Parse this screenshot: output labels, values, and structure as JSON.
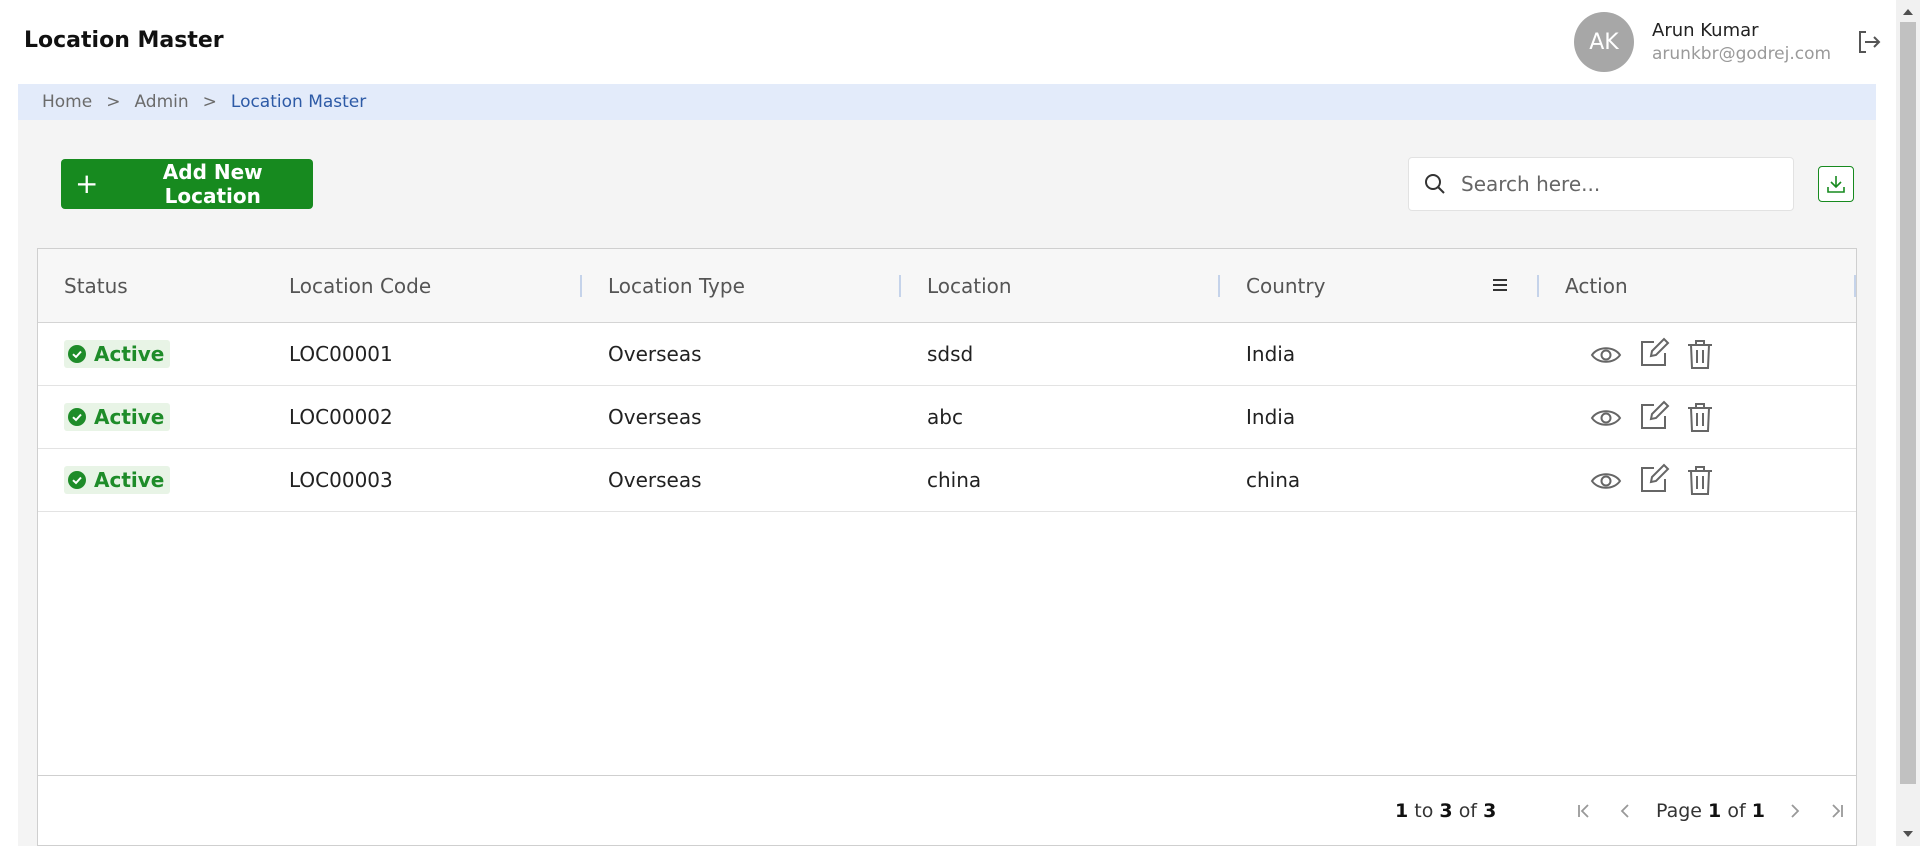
{
  "header": {
    "title": "Location Master",
    "user": {
      "initials": "AK",
      "name": "Arun Kumar",
      "email": "arunkbr@godrej.com"
    }
  },
  "breadcrumb": {
    "items": [
      "Home",
      "Admin",
      "Location Master"
    ],
    "separator": ">"
  },
  "toolbar": {
    "add_label": "Add New Location",
    "search_placeholder": "Search here...",
    "search_value": ""
  },
  "table": {
    "columns": [
      "Status",
      "Location Code",
      "Location Type",
      "Location",
      "Country",
      "Action"
    ],
    "rows": [
      {
        "status": "Active",
        "code": "LOC00001",
        "type": "Overseas",
        "location": "sdsd",
        "country": "India"
      },
      {
        "status": "Active",
        "code": "LOC00002",
        "type": "Overseas",
        "location": "abc",
        "country": "India"
      },
      {
        "status": "Active",
        "code": "LOC00003",
        "type": "Overseas",
        "location": "china",
        "country": "china"
      }
    ]
  },
  "pagination": {
    "from": "1",
    "to_word": "to",
    "to": "3",
    "of_word": "of",
    "total": "3",
    "page_word": "Page",
    "page": "1",
    "page_of_word": "of",
    "page_count": "1"
  },
  "colors": {
    "primary_green": "#178a1f",
    "breadcrumb_bg": "#e3ebfa",
    "breadcrumb_active": "#2d5aa6",
    "status_active": "#1e8c29"
  },
  "icons": [
    "logout-icon",
    "plus-icon",
    "search-icon",
    "download-icon",
    "column-menu-icon",
    "check-circle-icon",
    "eye-icon",
    "edit-icon",
    "trash-icon",
    "first-page-icon",
    "previous-page-icon",
    "next-page-icon",
    "last-page-icon"
  ]
}
